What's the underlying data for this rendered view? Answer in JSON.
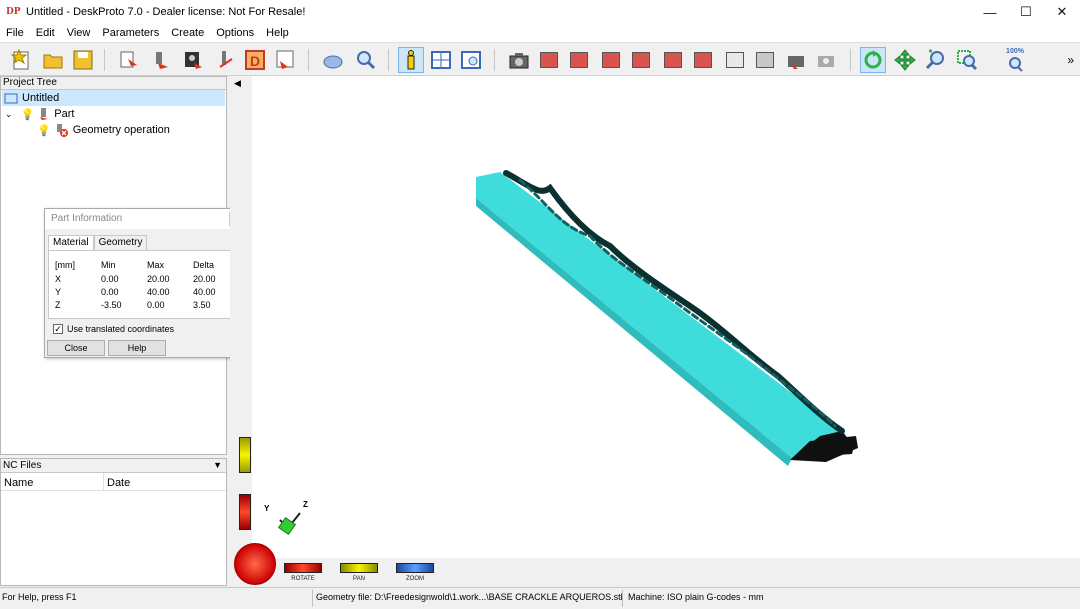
{
  "window": {
    "title": "Untitled - DeskProto 7.0 - Dealer license: Not For Resale!",
    "logo": "DP"
  },
  "menu": [
    "File",
    "Edit",
    "View",
    "Parameters",
    "Create",
    "Options",
    "Help"
  ],
  "toolbar": {
    "zoom_label": "100%"
  },
  "project_tree": {
    "header": "Project Tree",
    "items": [
      {
        "label": "Untitled"
      },
      {
        "label": "Part"
      },
      {
        "label": "Geometry operation"
      }
    ]
  },
  "nc_files": {
    "header": "NC Files",
    "columns": [
      "Name",
      "Date"
    ]
  },
  "part_info": {
    "title": "Part Information",
    "tabs": [
      "Material",
      "Geometry"
    ],
    "headers": [
      "[mm]",
      "Min",
      "Max",
      "Delta"
    ],
    "rows": [
      [
        "X",
        "0.00",
        "20.00",
        "20.00"
      ],
      [
        "Y",
        "0.00",
        "40.00",
        "40.00"
      ],
      [
        "Z",
        "-3.50",
        "0.00",
        "3.50"
      ]
    ],
    "checkbox_label": "Use translated coordinates",
    "close_label": "Close",
    "help_label": "Help"
  },
  "viewport": {
    "axes": {
      "y": "Y",
      "z": "Z"
    },
    "controls": {
      "rotate": "ROTATE",
      "pan": "PAN",
      "zoom": "ZOOM"
    },
    "model_color": "#40e0e0"
  },
  "status": {
    "help": "For Help, press F1",
    "geometry": "Geometry file: D:\\Freedesignwold\\1.work...\\BASE CRACKLE ARQUEROS.stl",
    "machine": "Machine: ISO plain G-codes - mm"
  }
}
